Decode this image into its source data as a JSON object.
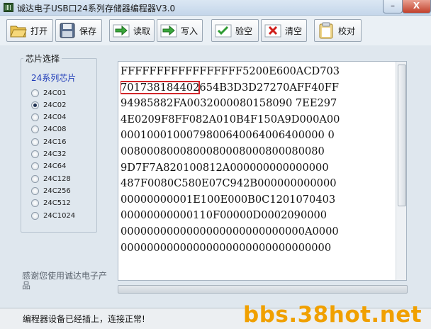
{
  "window": {
    "title": "诚达电子USB口24系列存储器编程器V3.0",
    "minimize_label": "–",
    "close_label": "X"
  },
  "toolbar": {
    "open_label": "打开",
    "save_label": "保存",
    "read_label": "读取",
    "write_label": "写入",
    "verify_label": "验空",
    "clear_label": "清空",
    "check_label": "校对"
  },
  "chip_select": {
    "group_title": "芯片选择",
    "series_title": "24系列芯片",
    "options": [
      "24C01",
      "24C02",
      "24C04",
      "24C08",
      "24C16",
      "24C32",
      "24C64",
      "24C128",
      "24C256",
      "24C512",
      "24C1024"
    ],
    "selected": "24C02"
  },
  "thanks_text": "感谢您使用诚达电子产品",
  "hex_data": {
    "lines": [
      "FFFFFFFFFFFFFFFFF5200E600ACD703",
      "701738184402654B3D3D27270AFF40FF",
      "94985882FA0032000080158090 7EE297",
      "4E0209F8FF082A010B4F150A9D000A00",
      "0001000100079800640064006400000 0",
      "0080008000800080008000800080080",
      "9D7F7A820100812A000000000000000",
      "487F0080C580E07C942B000000000000",
      "00000000001E100E000B0C1201070403",
      "00000000000110F00000D0002090000",
      "0000000000000000000000000000A0000",
      "00000000000000000000000000000000"
    ],
    "highlight_text": "701738184402",
    "highlight_rest": "654B3D3D27270AFF40FF"
  },
  "status": {
    "text": "编程器设备已经插上，连接正常!"
  },
  "watermark": "bbs.38hot.net"
}
